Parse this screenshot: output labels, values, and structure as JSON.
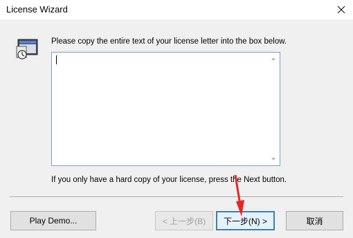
{
  "window": {
    "title": "License Wizard",
    "close_icon": "close-icon"
  },
  "main": {
    "icon": "license-wizard-icon",
    "instruction": "Please copy the entire text of your license letter into the box below.",
    "license_text": "",
    "hint": "If you only have a hard copy of your license, press the Next button."
  },
  "buttons": {
    "play_demo": "Play Demo...",
    "back": "< 上一步(B)",
    "next": "下一步(N) >",
    "cancel": "取消"
  },
  "colors": {
    "accent": "#3c7fb1",
    "annotation_arrow": "#e8261f"
  }
}
